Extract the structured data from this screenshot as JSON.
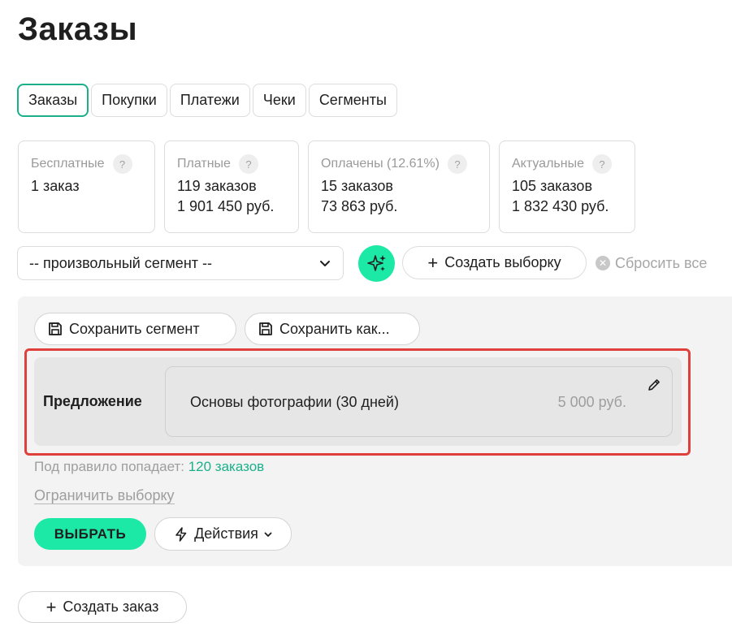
{
  "header": {
    "title": "Заказы"
  },
  "tabs": [
    {
      "label": "Заказы",
      "active": true
    },
    {
      "label": "Покупки",
      "active": false
    },
    {
      "label": "Платежи",
      "active": false
    },
    {
      "label": "Чеки",
      "active": false
    },
    {
      "label": "Сегменты",
      "active": false
    }
  ],
  "stats": [
    {
      "title": "Бесплатные",
      "help": "?",
      "line1": "1 заказ",
      "line2": ""
    },
    {
      "title": "Платные",
      "help": "?",
      "line1": "119 заказов",
      "line2": "1 901 450 руб."
    },
    {
      "title": "Оплачены (12.61%)",
      "help": "?",
      "line1": "15 заказов",
      "line2": "73 863 руб."
    },
    {
      "title": "Актуальные",
      "help": "?",
      "line1": "105 заказов",
      "line2": "1 832 430 руб."
    }
  ],
  "filter": {
    "segment_value": "-- произвольный сегмент --",
    "create_selection_label": "Создать выборку",
    "reset_label": "Сбросить все"
  },
  "panel": {
    "save_segment_label": "Сохранить сегмент",
    "save_as_label": "Сохранить как...",
    "condition": {
      "label": "Предложение",
      "offer_name": "Основы фотографии (30 дней)",
      "offer_price": "5 000 руб."
    },
    "rule_prefix": "Под правило попадает:",
    "rule_count": "120 заказов",
    "limit_label": "Ограничить выборку",
    "select_label": "ВЫБРАТЬ",
    "actions_label": "Действия"
  },
  "footer": {
    "create_order_label": "Создать заказ"
  },
  "colors": {
    "accent": "#1de9a6",
    "accent_text": "#1bb08a",
    "highlight": "#e0403b"
  }
}
